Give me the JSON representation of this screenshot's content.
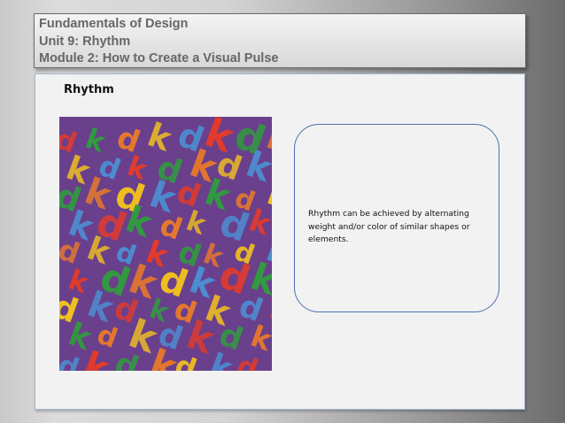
{
  "header": {
    "line1": "Fundamentals of Design",
    "line2": "Unit 9: Rhythm",
    "line3": "Module 2: How to Create a Visual Pulse"
  },
  "slide": {
    "heading": "Rhythm",
    "callout_text": "Rhythm can be achieved by alternating weight and/or color of similar shapes or elements.",
    "image_name": "rhythm-letters-artwork",
    "image_letters": [
      "d",
      "k"
    ],
    "image_colors": [
      "#e23b2c",
      "#f0c020",
      "#2f9e3d",
      "#4c8fd4",
      "#ea7a2a",
      "#6a3f8c"
    ]
  }
}
